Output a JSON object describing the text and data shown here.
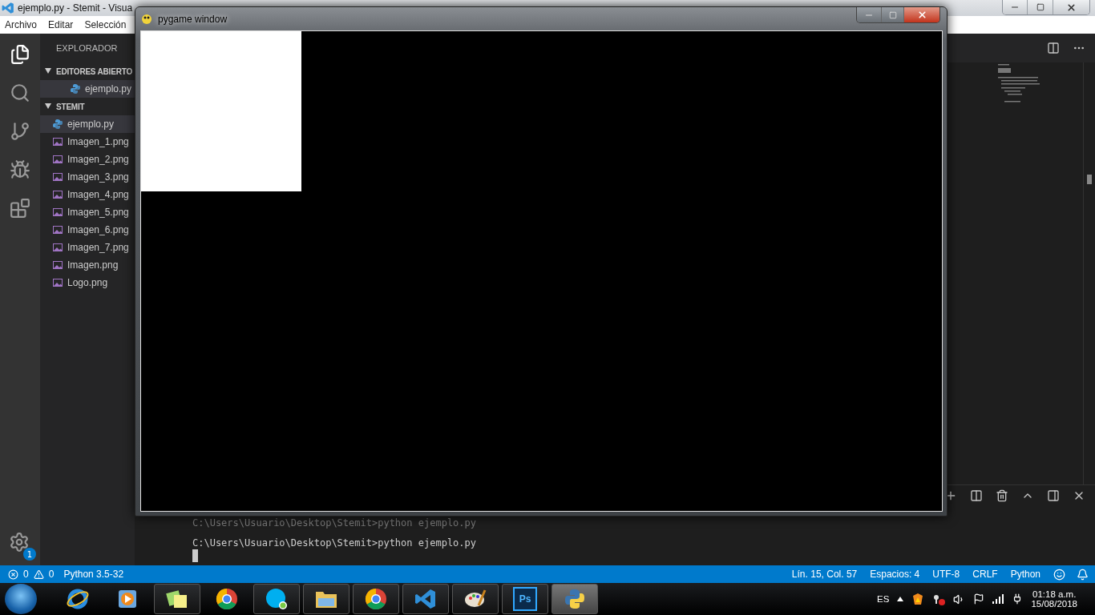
{
  "vscode": {
    "title": "ejemplo.py - Stemit - Visua",
    "menu": [
      "Archivo",
      "Editar",
      "Selección"
    ],
    "explorer": {
      "header": "EXPLORADOR",
      "sections": [
        {
          "title": "EDITORES ABIERTO",
          "expanded": true,
          "items": [
            {
              "name": "ejemplo.py",
              "kind": "python",
              "selected": true
            }
          ]
        },
        {
          "title": "STEMIT",
          "expanded": true,
          "items": [
            {
              "name": "ejemplo.py",
              "kind": "python",
              "selected": true
            },
            {
              "name": "Imagen_1.png",
              "kind": "image",
              "selected": false
            },
            {
              "name": "Imagen_2.png",
              "kind": "image",
              "selected": false
            },
            {
              "name": "Imagen_3.png",
              "kind": "image",
              "selected": false
            },
            {
              "name": "Imagen_4.png",
              "kind": "image",
              "selected": false
            },
            {
              "name": "Imagen_5.png",
              "kind": "image",
              "selected": false
            },
            {
              "name": "Imagen_6.png",
              "kind": "image",
              "selected": false
            },
            {
              "name": "Imagen_7.png",
              "kind": "image",
              "selected": false
            },
            {
              "name": "Imagen.png",
              "kind": "image",
              "selected": false
            },
            {
              "name": "Logo.png",
              "kind": "image",
              "selected": false
            }
          ]
        }
      ]
    },
    "settings_badge": "1",
    "terminal": {
      "lines": [
        "C:\\Users\\Usuario\\Desktop\\Stemit>python ejemplo.py",
        "C:\\Users\\Usuario\\Desktop\\Stemit>python ejemplo.py"
      ]
    },
    "status_bar": {
      "errors": "0",
      "warnings": "0",
      "interpreter": "Python 3.5-32",
      "right": [
        "Lín. 15, Col. 57",
        "Espacios: 4",
        "UTF-8",
        "CRLF",
        "Python"
      ]
    }
  },
  "pygame_window": {
    "title": "pygame window"
  },
  "taskbar": {
    "apps": [
      {
        "kind": "ie",
        "running": false,
        "selected": false
      },
      {
        "kind": "media",
        "running": false,
        "selected": false
      },
      {
        "kind": "notes",
        "running": true,
        "selected": false
      },
      {
        "kind": "chrome",
        "running": false,
        "selected": false
      },
      {
        "kind": "skype",
        "running": true,
        "selected": false
      },
      {
        "kind": "folder",
        "running": true,
        "selected": false
      },
      {
        "kind": "chrome",
        "running": true,
        "selected": false
      },
      {
        "kind": "vscode",
        "running": true,
        "selected": false
      },
      {
        "kind": "paint",
        "running": true,
        "selected": false
      },
      {
        "kind": "photoshop",
        "label": "Ps",
        "running": true,
        "selected": false
      },
      {
        "kind": "python",
        "running": true,
        "selected": true
      }
    ],
    "language": "ES",
    "time": "01:18 a.m.",
    "date": "15/08/2018"
  }
}
